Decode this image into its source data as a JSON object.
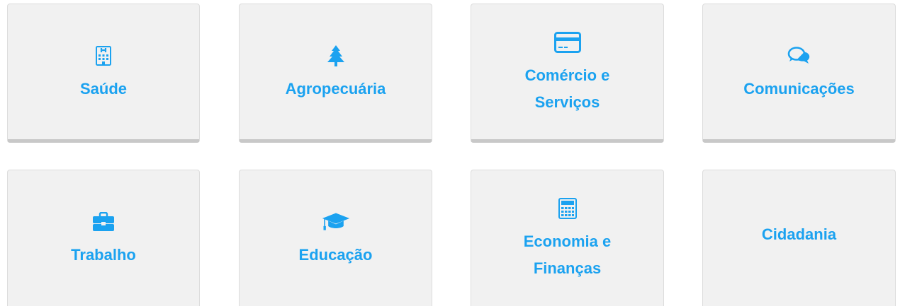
{
  "accent_color": "#1ba2f0",
  "tiles": [
    {
      "label": "Saúde",
      "icon": "hospital-building-icon"
    },
    {
      "label": "Agropecuária",
      "icon": "tree-icon"
    },
    {
      "label": "Comércio e Serviços",
      "icon": "credit-card-icon"
    },
    {
      "label": "Comunicações",
      "icon": "chat-bubbles-icon"
    },
    {
      "label": "Trabalho",
      "icon": "briefcase-icon"
    },
    {
      "label": "Educação",
      "icon": "graduation-cap-icon"
    },
    {
      "label": "Economia e Finanças",
      "icon": "calculator-icon"
    },
    {
      "label": "Cidadania",
      "icon": ""
    }
  ]
}
